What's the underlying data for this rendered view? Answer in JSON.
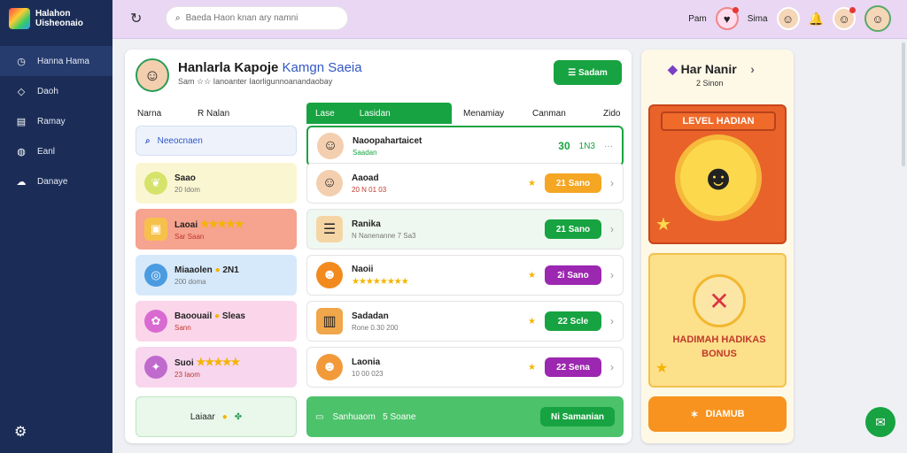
{
  "app": {
    "logo_line1": "Halahon",
    "logo_line2": "Uisheonaio"
  },
  "sidebar": {
    "items": [
      {
        "label": "Hanna Hama",
        "icon": "clock-icon"
      },
      {
        "label": "Daoh",
        "icon": "diamond-icon"
      },
      {
        "label": "Ramay",
        "icon": "calendar-icon"
      },
      {
        "label": "Eanl",
        "icon": "globe-icon"
      },
      {
        "label": "Danaye",
        "icon": "cloud-icon"
      }
    ]
  },
  "topbar": {
    "search_placeholder": "Baeda Haon knan ary namni",
    "user_label": "Pam",
    "user2_label": "Sima"
  },
  "main": {
    "title": "Hanlarla Kapoje",
    "title_accent": "Kamgn Saeia",
    "subtitle": "Sam ☆☆ Ianoanter Iaorligunnoanandaobay",
    "header_button": "☰ Sadam",
    "col1_a": "Narna",
    "col1_b": "R Nalan",
    "tab_a": "Lase",
    "tab_b": "Lasidan",
    "col_c": "Menamiay",
    "col_d": "Canman",
    "col_e": "Zido",
    "left_cards": [
      {
        "title": "Neeocnaen",
        "sub": ""
      },
      {
        "title": "Saao",
        "sub": "20 Idom"
      },
      {
        "title": "Laoai",
        "sub": "Sar Saan"
      },
      {
        "title": "Miaaolen",
        "sub": "200 doma",
        "extra": "2N1"
      },
      {
        "title": "Baoouail",
        "sub": "Sann",
        "extra": "Sleas"
      },
      {
        "title": "Suoi",
        "sub": "23 Iaom"
      }
    ],
    "bottom_left": "Laiaar",
    "rows": [
      {
        "title": "Naoopahartaicet",
        "sub": "Saadan",
        "value": "30",
        "value2": "1N3"
      },
      {
        "title": "Aaoad",
        "sub": "20 N 01 03",
        "pill": "21 Sano",
        "color": "#f5a623"
      },
      {
        "title": "Ranika",
        "sub": "N Nanenanne 7 Sa3",
        "pill": "21 Sano",
        "color": "#17a341"
      },
      {
        "title": "Naoii",
        "sub": "",
        "pill": "2i Sano",
        "color": "#9c27b0"
      },
      {
        "title": "Sadadan",
        "sub": "Rone 0.30 200",
        "pill": "22 Scle",
        "color": "#17a341"
      },
      {
        "title": "Laonia",
        "sub": "10 00 023",
        "pill": "22 Sena",
        "color": "#9c27b0"
      }
    ],
    "bottom_row_a": "Sanhuaom",
    "bottom_row_b": "5 Soane",
    "bottom_row_btn": "Ni Samanian"
  },
  "panel": {
    "head": "Har Nanir",
    "sub": "2 Sinon",
    "level": "LEVEL HADIAN",
    "bonus_line1": "HADIMAH HADIKAS",
    "bonus_line2": "BONUS",
    "cta": "DIAMUB"
  }
}
